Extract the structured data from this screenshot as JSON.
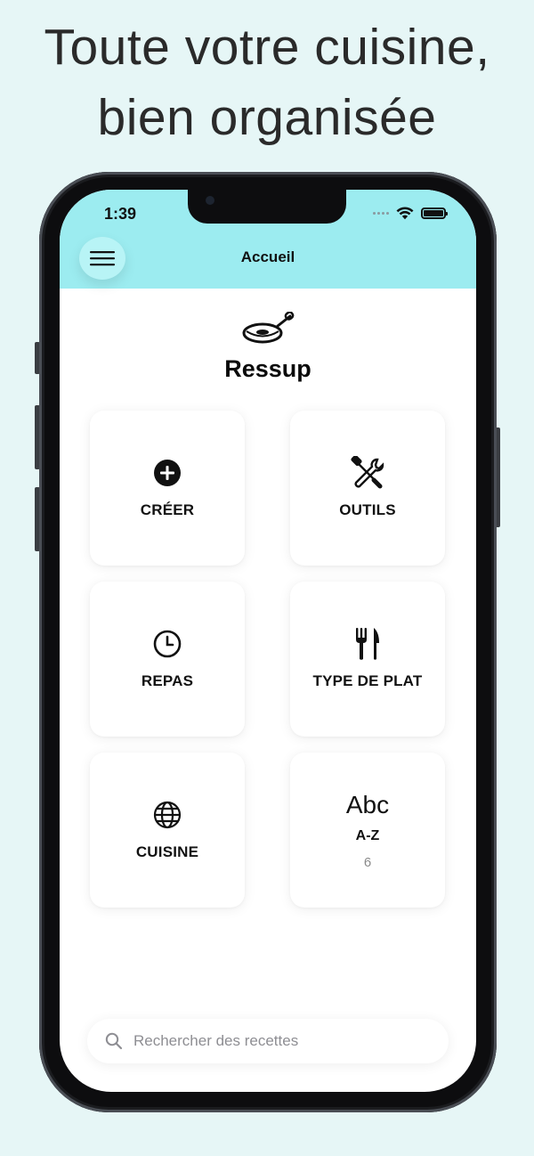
{
  "headline": {
    "line1": "Toute votre cuisine,",
    "line2": "bien organisée"
  },
  "status_bar": {
    "time": "1:39",
    "icons": [
      "cellular-dots-icon",
      "wifi-icon",
      "battery-icon"
    ]
  },
  "header": {
    "title": "Accueil",
    "menu_icon": "hamburger-icon",
    "background": "#9cecf0"
  },
  "app": {
    "name": "Ressup",
    "logo_icon": "frying-pan-icon"
  },
  "tiles": [
    {
      "label": "CRÉER",
      "icon": "plus-circle-icon"
    },
    {
      "label": "OUTILS",
      "icon": "tools-icon"
    },
    {
      "label": "REPAS",
      "icon": "clock-icon"
    },
    {
      "label": "TYPE DE PLAT",
      "icon": "fork-knife-icon"
    },
    {
      "label": "CUISINE",
      "icon": "globe-icon"
    },
    {
      "label": "A-Z",
      "icon_text": "Abc",
      "count": "6"
    }
  ],
  "search": {
    "placeholder": "Rechercher des recettes",
    "value": ""
  }
}
